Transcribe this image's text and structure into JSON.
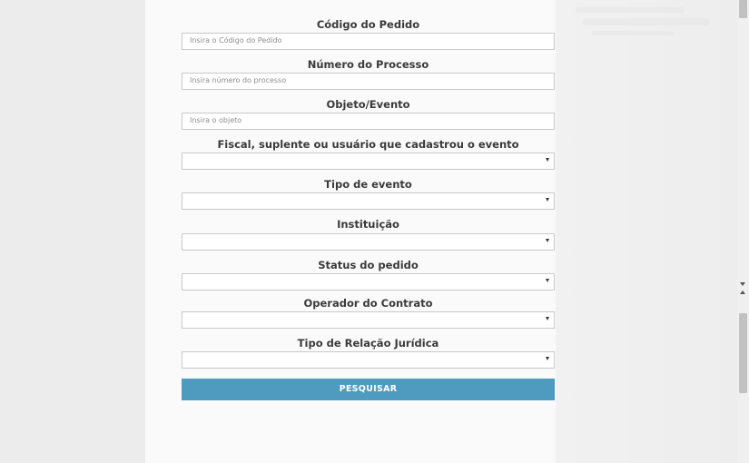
{
  "form": {
    "codigo_pedido": {
      "label": "Código do Pedido",
      "placeholder": "Insira o Código do Pedido"
    },
    "numero_processo": {
      "label": "Número do Processo",
      "placeholder": "Insira número do processo"
    },
    "objeto_evento": {
      "label": "Objeto/Evento",
      "placeholder": "Insira o objeto"
    },
    "fiscal": {
      "label": "Fiscal, suplente ou usuário que cadastrou o evento",
      "value": ""
    },
    "tipo_evento": {
      "label": "Tipo de evento",
      "value": ""
    },
    "instituicao": {
      "label": "Instituição",
      "value": ""
    },
    "status_pedido": {
      "label": "Status do pedido",
      "value": ""
    },
    "operador_contrato": {
      "label": "Operador do Contrato",
      "value": ""
    },
    "tipo_relacao_juridica": {
      "label": "Tipo de Relação Jurídica",
      "value": ""
    },
    "search_button_label": "PESQUISAR"
  },
  "colors": {
    "button_bg": "#4f9bbf",
    "button_text": "#ffffff",
    "label_text": "#3a3a3a",
    "placeholder_text": "#8d8d8d",
    "input_border": "#c9c9c9",
    "panel_bg": "#fafafa",
    "page_bg": "#ececec"
  },
  "icons": {
    "select_arrow": "caret-down-icon",
    "scroll_up": "scroll-up-arrow-icon",
    "scroll_down": "scroll-down-arrow-icon"
  }
}
